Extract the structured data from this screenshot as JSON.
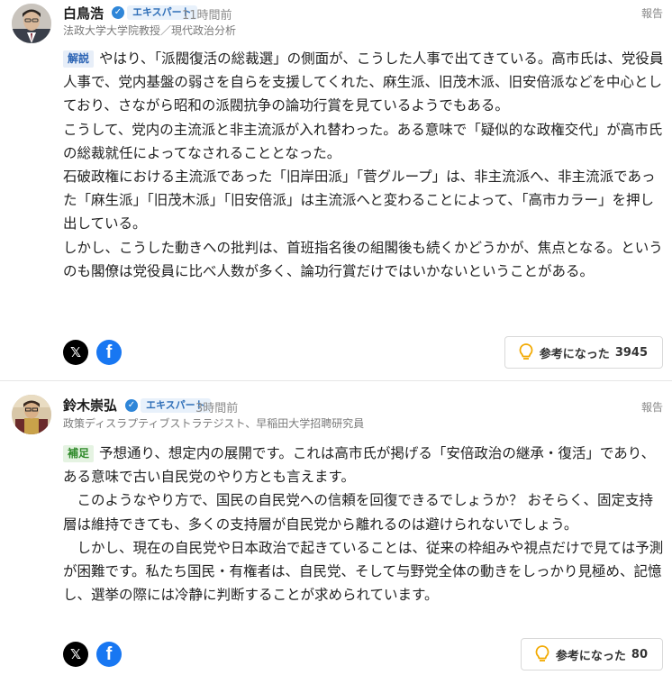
{
  "comments": [
    {
      "author": "白鳥浩",
      "badge": "エキスパート",
      "time": "11時間前",
      "title": "法政大学大学院教授／現代政治分析",
      "report": "報告",
      "tag": "解説",
      "body": "やはり、「派閥復活の総裁選」の側面が、こうした人事で出てきている。高市氏は、党役員人事で、党内基盤の弱さを自らを支援してくれた、麻生派、旧茂木派、旧安倍派などを中心としており、さながら昭和の派閥抗争の論功行賞を見ているようでもある。\nこうして、党内の主流派と非主流派が入れ替わった。ある意味で「疑似的な政権交代」が高市氏の総裁就任によってなされることとなった。\n石破政権における主流派であった「旧岸田派」「菅グループ」は、非主流派へ、非主流派であった「麻生派」「旧茂木派」「旧安倍派」は主流派へと変わることによって、「高市カラー」を押し出している。\nしかし、こうした動きへの批判は、首班指名後の組閣後も続くかどうかが、焦点となる。というのも閣僚は党役員に比べ人数が多く、論功行賞だけではいかないということがある。",
      "helpful_label": "参考になった",
      "helpful_count": "3945"
    },
    {
      "author": "鈴木崇弘",
      "badge": "エキスパート",
      "time": "3時間前",
      "title": "政策ディスラプティブストラテジスト、早稲田大学招聘研究員",
      "report": "報告",
      "tag": "補足",
      "body": "予想通り、想定内の展開です。これは高市氏が掲げる「安倍政治の継承・復活」であり、ある意味で古い自民党のやり方とも言えます。\n　このようなやり方で、国民の自民党への信頼を回復できるでしょうか？ おそらく、固定支持層は維持できても、多くの支持層が自民党から離れるのは避けられないでしょう。\n　しかし、現在の自民党や日本政治で起きていることは、従来の枠組みや視点だけで見ては予測が困難です。私たち国民・有権者は、自民党、そして与野党全体の動きをしっかり見極め、記憶し、選挙の際には冷静に判断することが求められています。",
      "helpful_label": "参考になった",
      "helpful_count": "80"
    }
  ],
  "icons": {
    "x_share": "x-logo-icon",
    "fb_share": "facebook-logo-icon",
    "helpful": "lightbulb-icon",
    "verified": "check-badge-icon"
  },
  "colors": {
    "x": "#000000",
    "facebook": "#1877f2",
    "badge_blue": "#2f86d8",
    "bulb": "#f2a900"
  }
}
